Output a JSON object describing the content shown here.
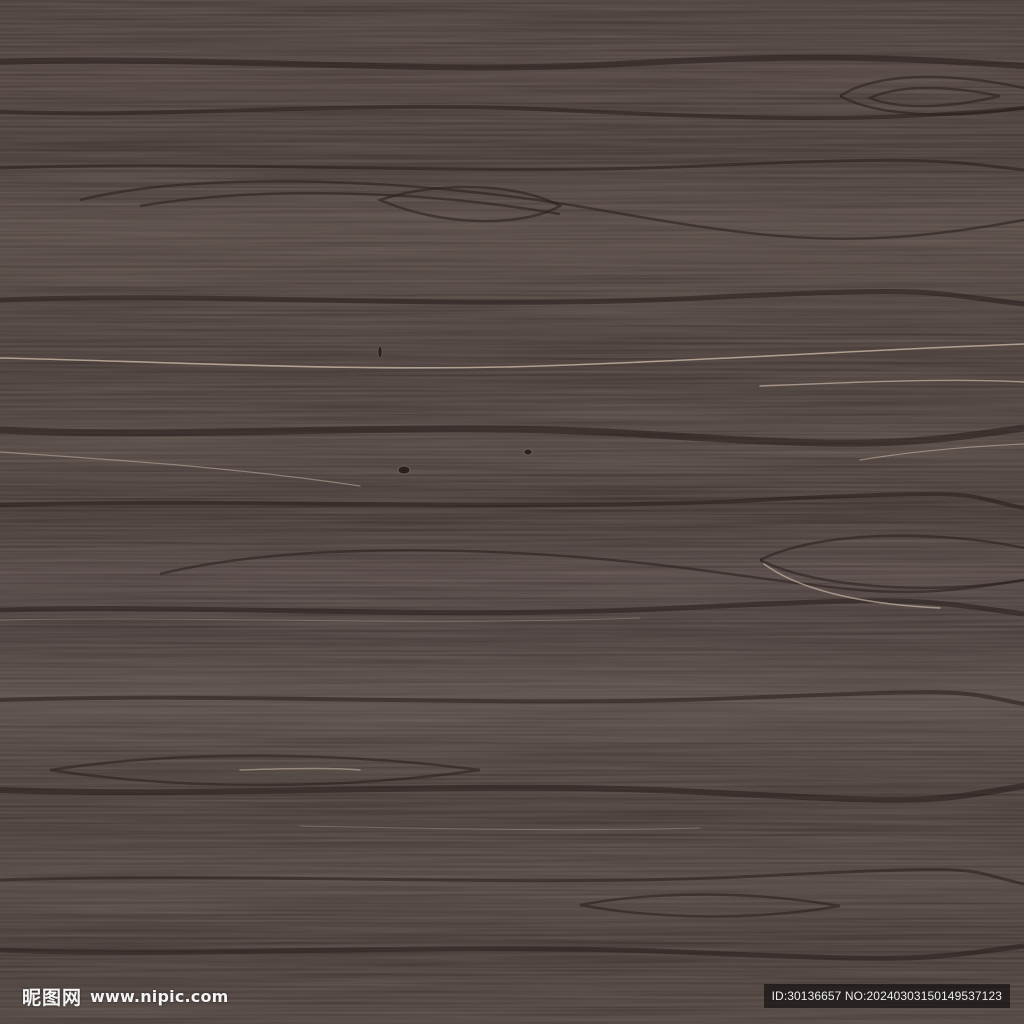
{
  "image": {
    "subject_icon": "wood-grain-texture",
    "palette": [
      "#3a2f2b",
      "#4d4140",
      "#5b4f49",
      "#2b2320",
      "#c9b7a6"
    ]
  },
  "watermark": {
    "brand": "昵图网",
    "url": "www.nipic.com",
    "id_text": "ID:30136657 NO:20240303150149537123"
  }
}
